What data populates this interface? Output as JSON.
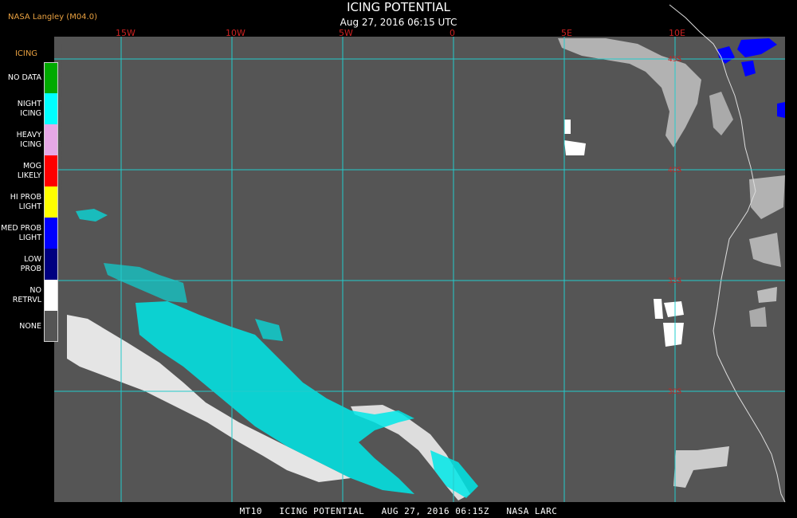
{
  "header": {
    "credit": "NASA Langley (M04.0)",
    "title": "ICING POTENTIAL",
    "subtitle": "Aug 27, 2016 06:15 UTC"
  },
  "legend": {
    "title": "ICING",
    "items": [
      {
        "label": "NO DATA",
        "color": "#00aa00"
      },
      {
        "label": "NIGHT\nICING",
        "color": "#00ffff"
      },
      {
        "label": "HEAVY\nICING",
        "color": "#e6a8e6"
      },
      {
        "label": "MOG\nLIKELY",
        "color": "#ff0000"
      },
      {
        "label": "HI PROB\nLIGHT",
        "color": "#ffff00"
      },
      {
        "label": "MED PROB\nLIGHT",
        "color": "#0000ff"
      },
      {
        "label": "LOW\nPROB",
        "color": "#000080"
      },
      {
        "label": "NO\nRETRVL",
        "color": "#ffffff"
      },
      {
        "label": "NONE",
        "color": "#555555"
      }
    ]
  },
  "map": {
    "background_color": "#555555",
    "grid_color": "#22cccc",
    "longitude_labels": [
      "15W",
      "10W",
      "5W",
      "0",
      "5E",
      "10E"
    ],
    "latitude_labels": [
      "45S",
      "40S",
      "35S",
      "30S"
    ]
  },
  "footer": {
    "text": "MT10   ICING POTENTIAL   AUG 27, 2016 06:15Z   NASA LARC"
  }
}
